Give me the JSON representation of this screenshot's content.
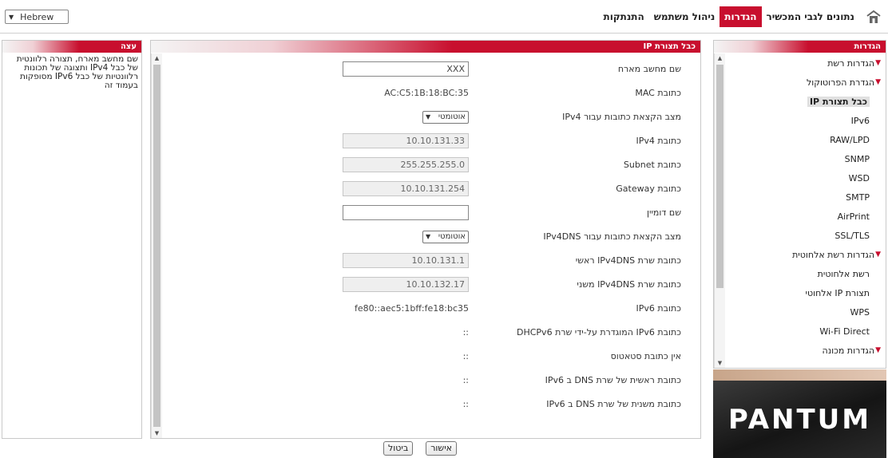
{
  "language": {
    "selected": "Hebrew"
  },
  "nav": {
    "tabs": [
      {
        "label": "נתונים לגבי המכשיר",
        "active": false
      },
      {
        "label": "הגדרות",
        "active": true
      },
      {
        "label": "ניהול משתמש",
        "active": false
      },
      {
        "label": "התנתקות",
        "active": false
      }
    ]
  },
  "sidebar": {
    "title": "הגדרות",
    "items": [
      {
        "label": "הגדרות רשת",
        "type": "cat"
      },
      {
        "label": "הגדרת הפרוטוקול",
        "type": "cat"
      },
      {
        "label": "כבל תצורת IP",
        "type": "sub",
        "selected": true
      },
      {
        "label": "IPv6",
        "type": "sub"
      },
      {
        "label": "RAW/LPD",
        "type": "sub"
      },
      {
        "label": "SNMP",
        "type": "sub"
      },
      {
        "label": "WSD",
        "type": "sub"
      },
      {
        "label": "SMTP",
        "type": "sub"
      },
      {
        "label": "AirPrint",
        "type": "sub"
      },
      {
        "label": "SSL/TLS",
        "type": "sub"
      },
      {
        "label": "הגדרות רשת אלחוטית",
        "type": "cat"
      },
      {
        "label": "רשת אלחוטית",
        "type": "sub"
      },
      {
        "label": "תצורת IP אלחוטי",
        "type": "sub"
      },
      {
        "label": "WPS",
        "type": "sub"
      },
      {
        "label": "Wi-Fi Direct",
        "type": "sub"
      },
      {
        "label": "הגדרות מכונה",
        "type": "cat"
      }
    ]
  },
  "brand": {
    "logo_text": "PANTUM"
  },
  "main": {
    "title": "כבל תצורת IP",
    "fields": [
      {
        "label": "שם מחשב מארח",
        "kind": "input",
        "value": "XXX"
      },
      {
        "label": "כתובת MAC",
        "kind": "text",
        "value": "AC:C5:1B:18:BC:35"
      },
      {
        "label": "מצב הקצאת כתובות עבור IPv4",
        "kind": "select",
        "value": "אוטומטי"
      },
      {
        "label": "כתובת IPv4",
        "kind": "readonly",
        "value": "10.10.131.33"
      },
      {
        "label": "כתובת Subnet",
        "kind": "readonly",
        "value": "255.255.255.0"
      },
      {
        "label": "כתובת Gateway",
        "kind": "readonly",
        "value": "10.10.131.254"
      },
      {
        "label": "שם דומיין",
        "kind": "input",
        "value": ""
      },
      {
        "label": "מצב הקצאת כתובות עבור IPv4DNS",
        "kind": "select",
        "value": "אוטומטי"
      },
      {
        "label": "כתובת שרת IPv4DNS ראשי",
        "kind": "readonly",
        "value": "10.10.131.1"
      },
      {
        "label": "כתובת שרת IPv4DNS משני",
        "kind": "readonly",
        "value": "10.10.132.17"
      },
      {
        "label": "כתובת IPv6",
        "kind": "text",
        "value": "fe80::aec5:1bff:fe18:bc35"
      },
      {
        "label": "כתובת IPv6 המוגדרת על-ידי שרת DHCPv6",
        "kind": "text",
        "value": "::"
      },
      {
        "label": "אין כתובת סטאטוס",
        "kind": "text",
        "value": "::"
      },
      {
        "label": "כתובת ראשית של שרת DNS ב IPv6",
        "kind": "text",
        "value": "::"
      },
      {
        "label": "כתובת משנית של שרת DNS ב IPv6",
        "kind": "text",
        "value": "::"
      }
    ]
  },
  "buttons": {
    "ok": "אישור",
    "cancel": "ביטול"
  },
  "tip": {
    "title": "עצה",
    "text": "שם מחשב מארח, תצורה רלוונטית של כבל IPv4 ותצוגה של תכונות רלוונטיות של כבל IPv6 מסופקות בעמוד זה"
  },
  "colors": {
    "accent": "#c80f2e"
  }
}
